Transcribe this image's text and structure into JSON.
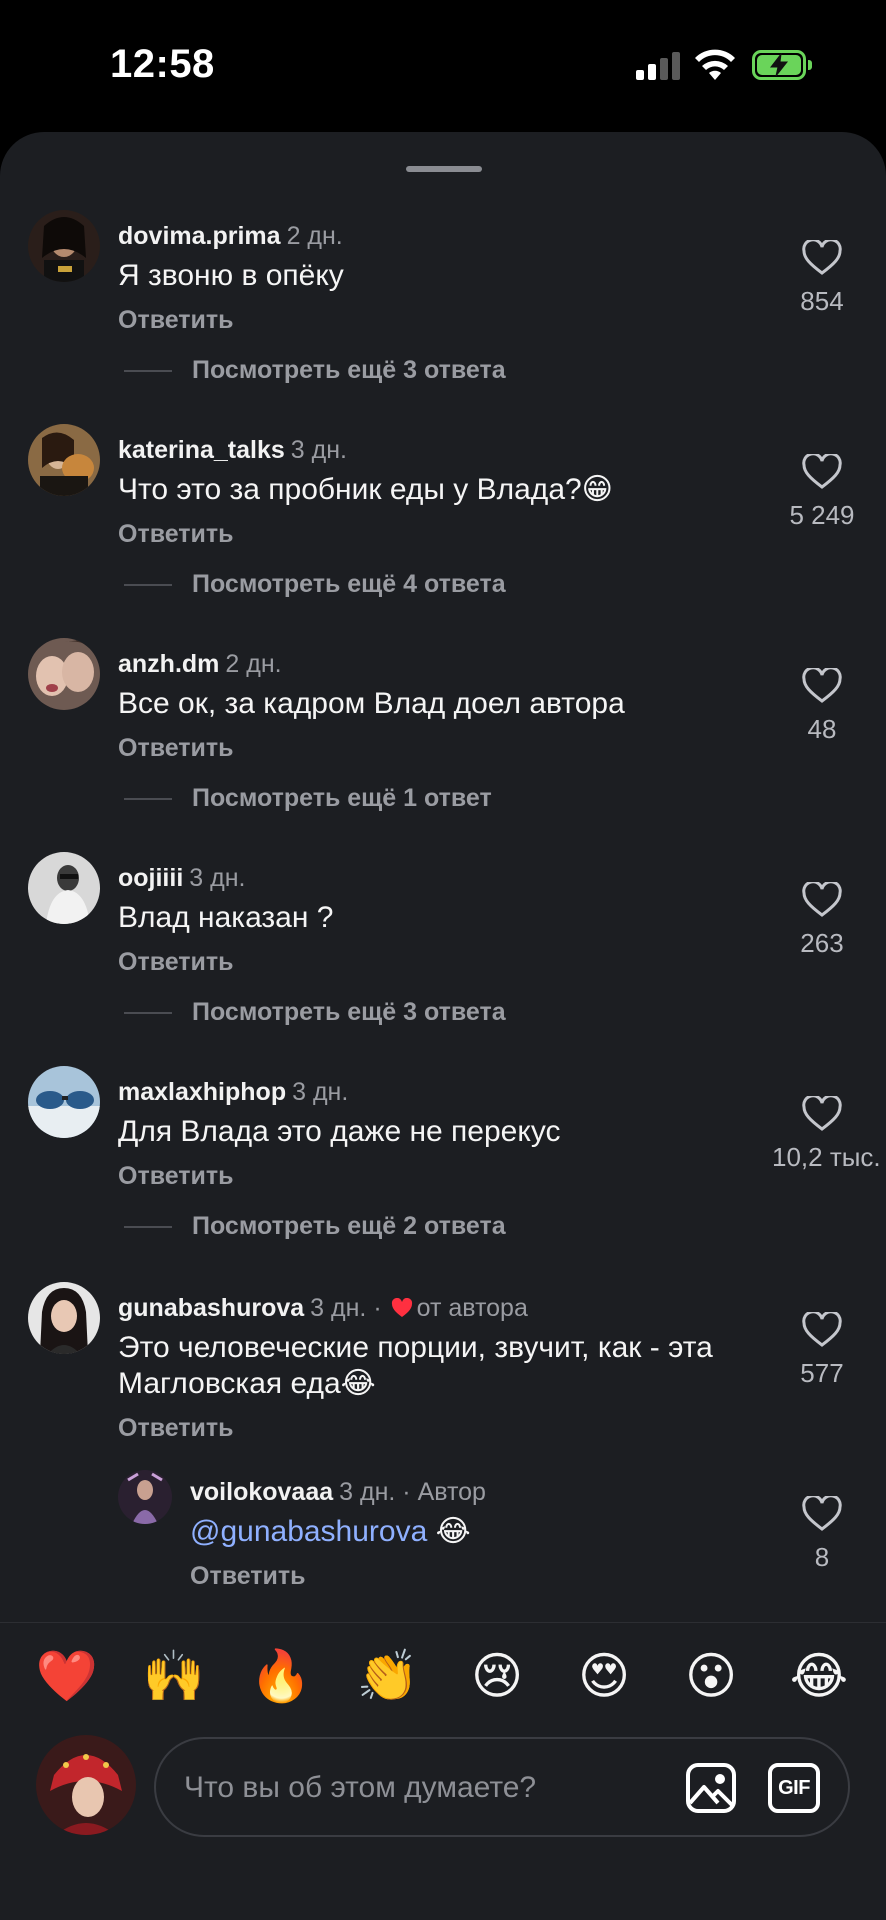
{
  "status": {
    "time": "12:58"
  },
  "comments": [
    {
      "user": "dovima.prima",
      "time": "2 дн.",
      "text": "Я звоню в опёку",
      "reply": "Ответить",
      "likes": "854",
      "more": "Посмотреть ещё 3 ответа"
    },
    {
      "user": "katerina_talks",
      "time": "3 дн.",
      "text": "Что это за пробник еды у Влада?😁",
      "reply": "Ответить",
      "likes": "5 249",
      "more": "Посмотреть ещё 4 ответа"
    },
    {
      "user": "anzh.dm",
      "time": "2 дн.",
      "text": "Все ок, за кадром Влад доел автора",
      "reply": "Ответить",
      "likes": "48",
      "more": "Посмотреть ещё 1 ответ"
    },
    {
      "user": "oojiiii",
      "time": "3 дн.",
      "text": "Влад наказан ?",
      "reply": "Ответить",
      "likes": "263",
      "more": "Посмотреть ещё 3 ответа"
    },
    {
      "user": "maxlaxhiphop",
      "time": "3 дн.",
      "text": "Для Влада это даже не перекус",
      "reply": "Ответить",
      "likes": "10,2 тыс.",
      "more": "Посмотреть ещё 2 ответа"
    },
    {
      "user": "gunabashurova",
      "time": "3 дн.",
      "extra_sep": "·",
      "extra": "от автора",
      "text": "Это человеческие порции, звучит, как - эта Магловская еда😂",
      "reply": "Ответить",
      "likes": "577"
    }
  ],
  "reply_comment": {
    "user": "voilokovaaa",
    "time": "3 дн.",
    "badge": "· Автор",
    "mention": "@gunabashurova",
    "text": " 😂",
    "reply": "Ответить",
    "likes": "8"
  },
  "emoji_bar": [
    "❤️",
    "🙌",
    "🔥",
    "👏",
    "😢",
    "😍",
    "😮",
    "😂"
  ],
  "composer": {
    "placeholder": "Что вы об этом думаете?",
    "gif_label": "GIF"
  },
  "colors": {
    "background": "#1c1e22",
    "accent_heart": "#ff3040",
    "mention": "#8fb0ff",
    "battery": "#6ad45a"
  }
}
